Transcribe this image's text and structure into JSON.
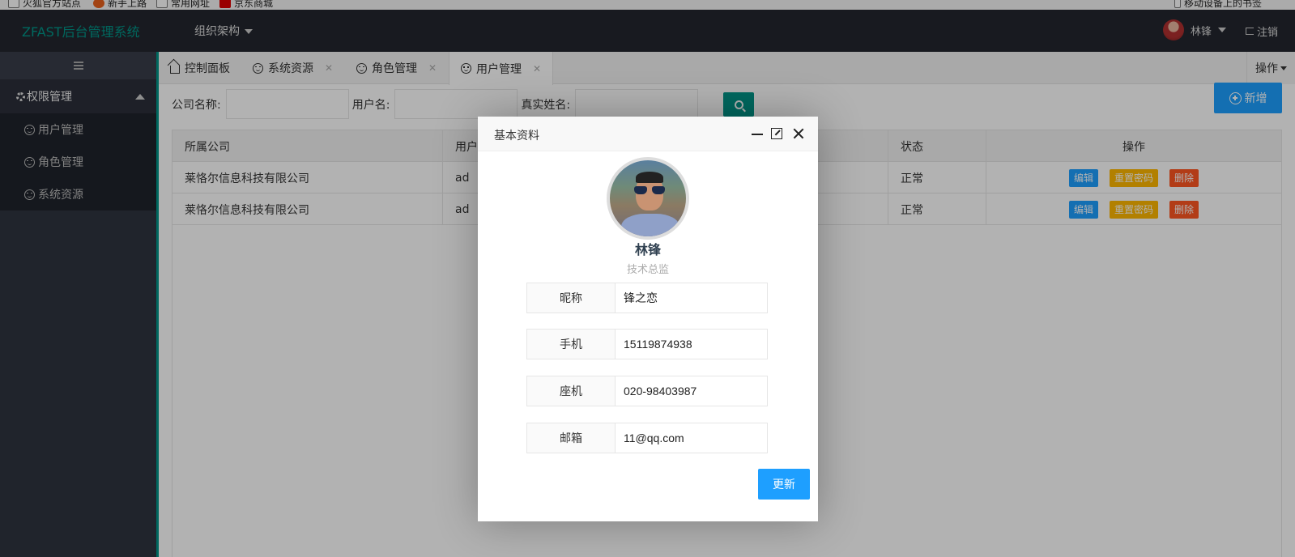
{
  "bookmarks": [
    "火狐官方站点",
    "新手上路",
    "常用网址",
    "京东商城"
  ],
  "bookmarks_right": "移动设备上的书签",
  "header": {
    "brand": "ZFAST后台管理系统",
    "nav_item": "组织架构",
    "user_name": "林锋",
    "logout": "注销"
  },
  "sidebar": {
    "group_label": "权限管理",
    "items": [
      {
        "label": "用户管理"
      },
      {
        "label": "角色管理"
      },
      {
        "label": "系统资源"
      }
    ]
  },
  "tabs": [
    {
      "label": "控制面板"
    },
    {
      "label": "系统资源"
    },
    {
      "label": "角色管理"
    },
    {
      "label": "用户管理"
    }
  ],
  "tabs_ops": "操作",
  "search": {
    "company_label": "公司名称:",
    "username_label": "用户名:",
    "realname_label": "真实姓名:"
  },
  "add_button": "新增",
  "table": {
    "headers": [
      "所属公司",
      "用户名",
      "",
      "状态",
      "操作"
    ],
    "rows": [
      {
        "company": "莱恪尔信息科技有限公司",
        "username": "ad",
        "status": "正常"
      },
      {
        "company": "莱恪尔信息科技有限公司",
        "username": "ad",
        "status": "正常"
      }
    ],
    "actions": {
      "edit": "编辑",
      "reset": "重置密码",
      "delete": "删除"
    }
  },
  "modal": {
    "title": "基本资料",
    "name": "林锋",
    "position": "技术总监",
    "fields": [
      {
        "label": "昵称",
        "value": "锋之恋"
      },
      {
        "label": "手机",
        "value": "15119874938"
      },
      {
        "label": "座机",
        "value": "020-98403987"
      },
      {
        "label": "邮箱",
        "value": "11@qq.com"
      }
    ],
    "update_button": "更新"
  },
  "colors": {
    "brand": "#009688",
    "primary": "#1e9fff",
    "warn": "#ffb800",
    "danger": "#ff5722",
    "header_bg": "#23262e",
    "sidebar_bg": "#2f3440"
  }
}
